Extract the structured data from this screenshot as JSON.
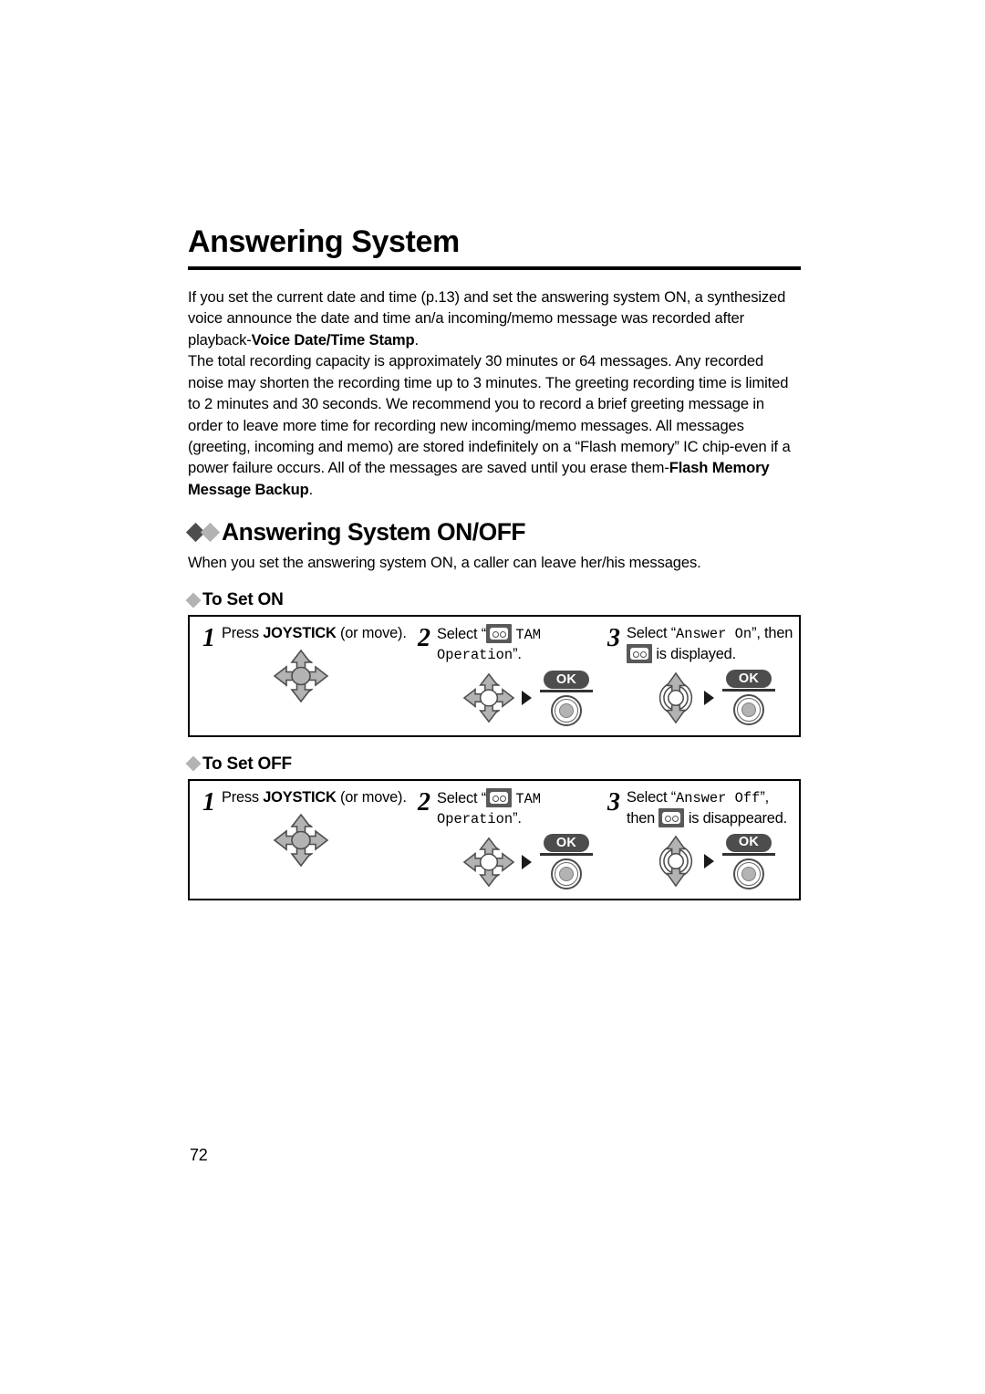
{
  "page": {
    "title": "Answering System",
    "number": "72"
  },
  "intro": {
    "paragraph1_a": "If you set the current date and time (p.13) and set the answering system ON, a synthesized voice announce the date and time an/a incoming/memo message was recorded after playback-",
    "paragraph1_bold": "Voice Date/Time Stamp",
    "paragraph1_b": ".",
    "paragraph2_a": "The total recording capacity is approximately 30 minutes or 64 messages. Any recorded noise may shorten the recording time up to 3 minutes. The greeting recording time is limited to 2 minutes and 30 seconds. We recommend you to record a brief greeting message in order to leave more time for recording new incoming/memo messages. All messages (greeting, incoming and memo) are stored indefinitely on a “Flash memory” IC chip-even if a power failure occurs. All of the messages are saved until you erase them-",
    "paragraph2_bold": "Flash Memory Message Backup",
    "paragraph2_b": "."
  },
  "section": {
    "heading": "Answering System ON/OFF",
    "intro": "When you set the answering system ON, a caller can leave her/his messages."
  },
  "procedures": [
    {
      "sub_heading": "To Set ON",
      "steps": [
        {
          "number": "1",
          "text_prefix": "Press ",
          "text_bold": "JOYSTICK",
          "text_suffix": " (or move).",
          "icon": "joystick-4way-icon"
        },
        {
          "number": "2",
          "text_prefix": "Select “",
          "display_icon": "tam-cassette-icon",
          "text_mono": "TAM Operation",
          "text_suffix": "”.",
          "icon": "joystick-4way-icon",
          "separator": "right-arrow-icon",
          "key_label": "OK"
        },
        {
          "number": "3",
          "text_prefix": "Select “",
          "text_mono": "Answer On",
          "text_mid": "”, then ",
          "display_icon": "tam-cassette-icon",
          "text_suffix": " is displayed.",
          "icon": "joystick-updown-icon",
          "separator": "right-arrow-icon",
          "key_label": "OK"
        }
      ]
    },
    {
      "sub_heading": "To Set OFF",
      "steps": [
        {
          "number": "1",
          "text_prefix": "Press ",
          "text_bold": "JOYSTICK",
          "text_suffix": " (or move).",
          "icon": "joystick-4way-icon"
        },
        {
          "number": "2",
          "text_prefix": "Select “",
          "display_icon": "tam-cassette-icon",
          "text_mono": "TAM Operation",
          "text_suffix": "”.",
          "icon": "joystick-4way-icon",
          "separator": "right-arrow-icon",
          "key_label": "OK"
        },
        {
          "number": "3",
          "text_prefix": "Select “",
          "text_mono": "Answer Off",
          "text_mid": "”, then ",
          "display_icon": "tam-cassette-icon",
          "text_suffix": " is disappeared.",
          "icon": "joystick-updown-icon",
          "separator": "right-arrow-icon",
          "key_label": "OK"
        }
      ]
    }
  ],
  "colors": {
    "diamond_dark": "#4d4d4d",
    "diamond_light": "#b3b3b3",
    "icon_gray": "#b3b3b3",
    "icon_outline": "#4d4d4d",
    "key_dark": "#4d4d4d"
  }
}
